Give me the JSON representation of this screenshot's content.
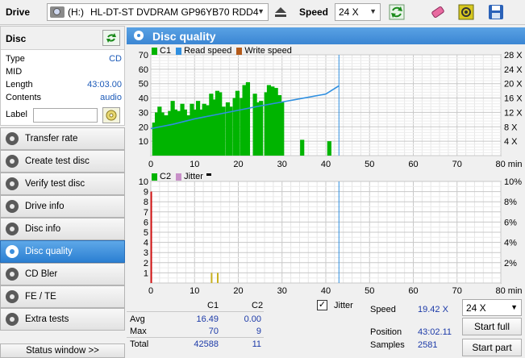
{
  "toolbar": {
    "drive_label": "Drive",
    "drive_letter": "(H:)",
    "drive_name": "HL-DT-ST DVDRAM GP96YB70 RDD4",
    "speed_label": "Speed",
    "speed_value": "24 X"
  },
  "disc_panel": {
    "title": "Disc",
    "rows": [
      {
        "key": "Type",
        "value": "CD"
      },
      {
        "key": "MID",
        "value": ""
      },
      {
        "key": "Length",
        "value": "43:03.00"
      },
      {
        "key": "Contents",
        "value": "audio"
      },
      {
        "key": "Label",
        "value": ""
      }
    ]
  },
  "nav": {
    "items": [
      {
        "label": "Transfer rate"
      },
      {
        "label": "Create test disc"
      },
      {
        "label": "Verify test disc"
      },
      {
        "label": "Drive info"
      },
      {
        "label": "Disc info"
      },
      {
        "label": "Disc quality"
      },
      {
        "label": "CD Bler"
      },
      {
        "label": "FE / TE"
      },
      {
        "label": "Extra tests"
      }
    ],
    "status_window": "Status window >>"
  },
  "panel": {
    "title": "Disc quality"
  },
  "colors": {
    "c1": "#00b400",
    "read": "#2f8fe0",
    "write": "#b45a1a",
    "c2": "#d01010",
    "jitter": "#c890c8",
    "accent": "#3d8ad6"
  },
  "chart_data": [
    {
      "type": "bar",
      "legend": [
        "C1",
        "Read speed",
        "Write speed"
      ],
      "x_ticks": [
        "0",
        "10",
        "20",
        "30",
        "40",
        "50",
        "60",
        "70",
        "80 min"
      ],
      "y_ticks_left": [
        "70",
        "60",
        "50",
        "40",
        "30",
        "20",
        "10"
      ],
      "y_ticks_right": [
        "28 X",
        "24 X",
        "20 X",
        "16 X",
        "12 X",
        "8 X",
        "4 X"
      ],
      "xlim": [
        0,
        80
      ],
      "ylim": [
        0,
        70
      ],
      "c1": [
        [
          0.8,
          23
        ],
        [
          1.4,
          30
        ],
        [
          2.0,
          34
        ],
        [
          2.6,
          30
        ],
        [
          3.2,
          28
        ],
        [
          3.8,
          28
        ],
        [
          4.4,
          31
        ],
        [
          5.0,
          38
        ],
        [
          5.6,
          32
        ],
        [
          6.4,
          31
        ],
        [
          7.2,
          36
        ],
        [
          7.8,
          32
        ],
        [
          8.6,
          28
        ],
        [
          9.4,
          36
        ],
        [
          10.0,
          32
        ],
        [
          10.8,
          38
        ],
        [
          11.6,
          32
        ],
        [
          12.2,
          36
        ],
        [
          13.0,
          35
        ],
        [
          13.8,
          43
        ],
        [
          14.4,
          39
        ],
        [
          15.2,
          45
        ],
        [
          15.8,
          44
        ],
        [
          16.6,
          34
        ],
        [
          17.6,
          37
        ],
        [
          18.2,
          34
        ],
        [
          19.2,
          40
        ],
        [
          19.8,
          45
        ],
        [
          20.8,
          40
        ],
        [
          21.4,
          49
        ],
        [
          22.2,
          51
        ],
        [
          23.8,
          43
        ],
        [
          24.4,
          37
        ],
        [
          25.2,
          38
        ],
        [
          26.4,
          44
        ],
        [
          27.0,
          49
        ],
        [
          27.8,
          48
        ],
        [
          28.6,
          47
        ],
        [
          29.4,
          42
        ],
        [
          30.0,
          37
        ],
        [
          34.6,
          11
        ],
        [
          40.8,
          10
        ]
      ],
      "read_speed": [
        [
          0,
          7.5
        ],
        [
          5,
          8.7
        ],
        [
          10,
          10.2
        ],
        [
          15,
          11.4
        ],
        [
          20,
          12.6
        ],
        [
          25,
          13.8
        ],
        [
          30,
          14.9
        ],
        [
          35,
          16.0
        ],
        [
          40,
          17.1
        ],
        [
          43,
          19.4
        ]
      ],
      "read_speed_unit": "X",
      "marker_x": 43
    },
    {
      "type": "bar",
      "legend": [
        "C2",
        "Jitter"
      ],
      "x_ticks": [
        "0",
        "10",
        "20",
        "30",
        "40",
        "50",
        "60",
        "70",
        "80 min"
      ],
      "y_ticks_left": [
        "10",
        "9",
        "8",
        "7",
        "6",
        "5",
        "4",
        "3",
        "2",
        "1"
      ],
      "y_ticks_right": [
        "10%",
        "8%",
        "6%",
        "4%",
        "2%"
      ],
      "xlim": [
        0,
        80
      ],
      "ylim": [
        0,
        10
      ],
      "c2": [
        [
          0.1,
          9
        ],
        [
          13.9,
          1
        ],
        [
          15.3,
          1
        ]
      ],
      "marker_x": 43
    }
  ],
  "stats": {
    "col_c1": "C1",
    "col_c2": "C2",
    "rows": [
      {
        "label": "Avg",
        "c1": "16.49",
        "c2": "0.00"
      },
      {
        "label": "Max",
        "c1": "70",
        "c2": "9"
      },
      {
        "label": "Total",
        "c1": "42588",
        "c2": "11"
      }
    ],
    "jitter_label": "Jitter",
    "jitter_checked": "✓",
    "speed_label": "Speed",
    "speed_value": "19.42 X",
    "position_label": "Position",
    "position_value": "43:02.11",
    "samples_label": "Samples",
    "samples_value": "2581",
    "speed_select": "24 X",
    "start_full": "Start full",
    "start_part": "Start part"
  }
}
